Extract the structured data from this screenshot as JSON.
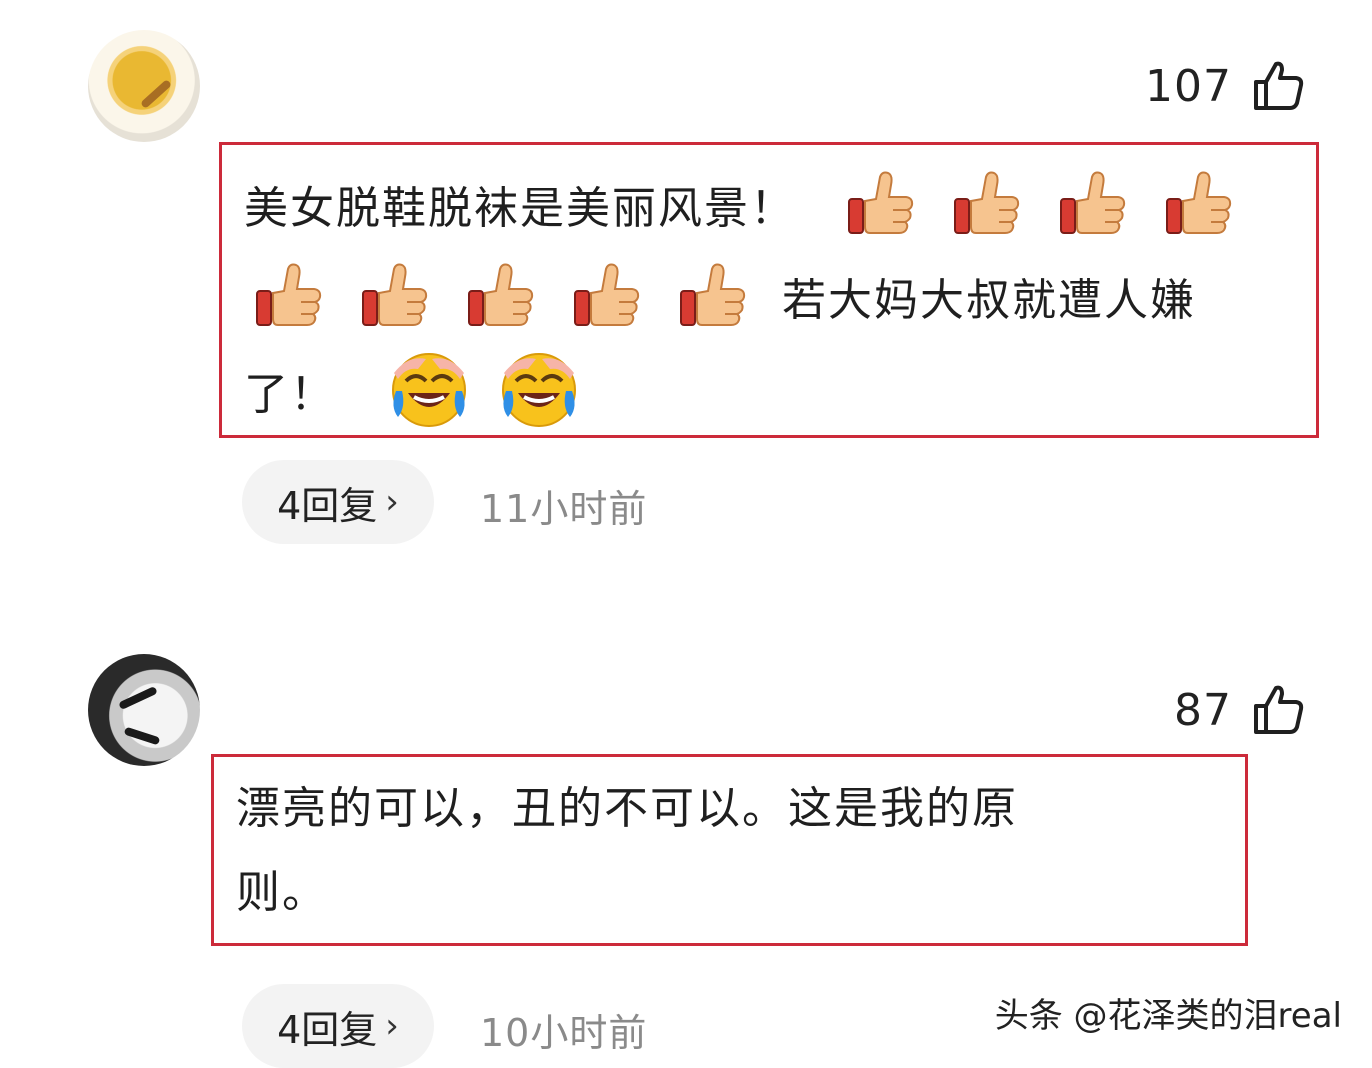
{
  "comments": [
    {
      "likes": "107",
      "text_part1": "美女脱鞋脱袜是美丽风景！",
      "text_part2": "若大妈大叔就遭人嫌",
      "text_part3": "了！",
      "replies": "4回复",
      "chevron": "›",
      "time": "11小时前",
      "emojis": [
        "thumbs-up-icon",
        "laughing-crying-icon"
      ]
    },
    {
      "likes": "87",
      "text_line1": "漂亮的可以，丑的不可以。这是我的原",
      "text_line2": "则。",
      "replies": "4回复",
      "chevron": "›",
      "time": "10小时前"
    }
  ],
  "watermark": "头条 @花泽类的泪real",
  "colors": {
    "highlight_border": "#cc2a3a",
    "reply_bg": "#f3f3f3",
    "time_text": "#8a8a8a"
  }
}
